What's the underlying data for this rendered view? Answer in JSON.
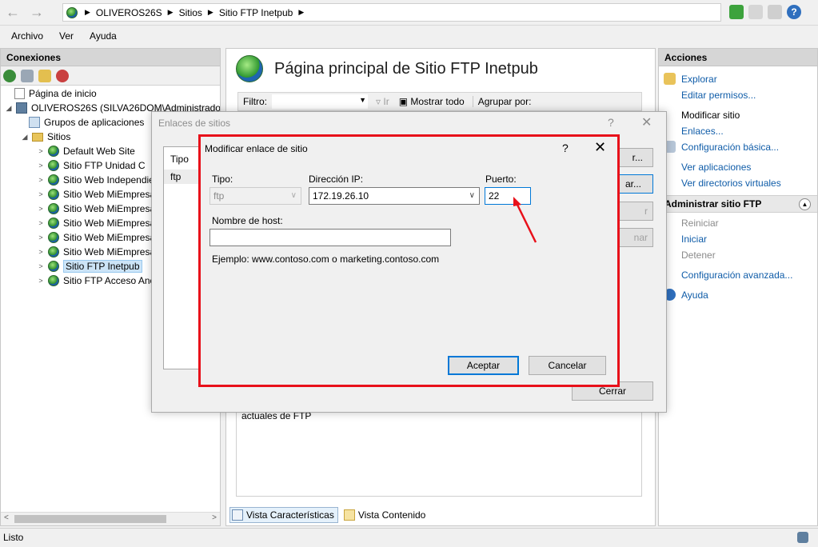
{
  "address_bar": {
    "crumbs": [
      "OLIVEROS26S",
      "Sitios",
      "Sitio FTP Inetpub"
    ]
  },
  "menu": [
    "Archivo",
    "Ver",
    "Ayuda"
  ],
  "connections": {
    "title": "Conexiones",
    "tree": [
      {
        "label": "Página de inicio",
        "icon": "home-page-icon"
      },
      {
        "label": "OLIVEROS26S (SILVA26DOM\\Administrador)",
        "icon": "server-icon"
      },
      {
        "label": "Grupos de aplicaciones",
        "icon": "app-pool-icon"
      },
      {
        "label": "Sitios",
        "icon": "folder-icon"
      },
      {
        "label": "Default Web Site",
        "icon": "globe-icon"
      },
      {
        "label": "Sitio FTP Unidad C",
        "icon": "globe-icon"
      },
      {
        "label": "Sitio Web Independie",
        "icon": "globe-icon"
      },
      {
        "label": "Sitio Web MiEmpresa",
        "icon": "globe-icon"
      },
      {
        "label": "Sitio Web MiEmpresa",
        "icon": "globe-icon"
      },
      {
        "label": "Sitio Web MiEmpresa",
        "icon": "globe-icon"
      },
      {
        "label": "Sitio Web MiEmpresa",
        "icon": "globe-icon"
      },
      {
        "label": "Sitio Web MiEmpresa",
        "icon": "globe-icon"
      },
      {
        "label": "Sitio FTP Inetpub",
        "icon": "globe-icon",
        "selected": true
      },
      {
        "label": "Sitio FTP Acceso Anó",
        "icon": "globe-icon"
      }
    ]
  },
  "center": {
    "title": "Página principal de Sitio FTP Inetpub",
    "filter_label": "Filtro:",
    "go_label": "Ir",
    "show_all_label": "Mostrar todo",
    "group_by_label": "Agrupar por:",
    "content_text": "actuales de FTP",
    "tabs": [
      "Vista Características",
      "Vista Contenido"
    ]
  },
  "actions": {
    "title": "Acciones",
    "items": [
      "Explorar",
      "Editar permisos...",
      "Modificar sitio",
      "Enlaces...",
      "Configuración básica...",
      "Ver aplicaciones",
      "Ver directorios virtuales"
    ],
    "ftp_section_title": "Administrar sitio FTP",
    "ftp_items": [
      "Reiniciar",
      "Iniciar",
      "Detener",
      "Configuración avanzada...",
      "Ayuda"
    ]
  },
  "status": "Listo",
  "bindings_dialog": {
    "title": "Enlaces de sitios",
    "help": "?",
    "list_header": "Tipo",
    "list_row": "ftp",
    "buttons": [
      "r...",
      "ar...",
      "r",
      "nar"
    ],
    "close_label": "Cerrar"
  },
  "edit_binding_dialog": {
    "title": "Modificar enlace de sitio",
    "help": "?",
    "type_label": "Tipo:",
    "type_value": "ftp",
    "ip_label": "Dirección IP:",
    "ip_value": "172.19.26.10",
    "port_label": "Puerto:",
    "port_value": "22",
    "host_label": "Nombre de host:",
    "host_value": "",
    "example_text": "Ejemplo: www.contoso.com o marketing.contoso.com",
    "ok_label": "Aceptar",
    "cancel_label": "Cancelar"
  },
  "colors": {
    "highlight_border": "#e8101a",
    "link": "#0f5ca8",
    "focus": "#0078d7"
  }
}
